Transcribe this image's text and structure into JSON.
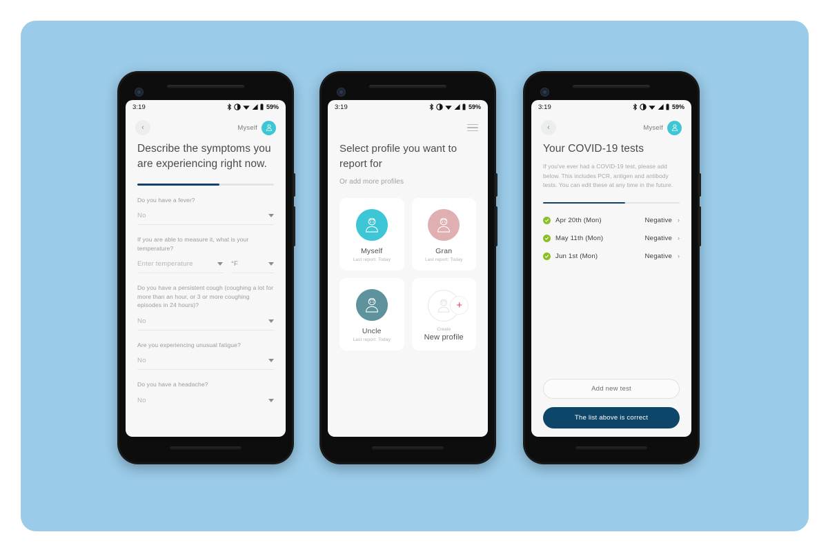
{
  "background": {
    "panel_color": "#9acbe9",
    "page_color": "#ffffff"
  },
  "colors": {
    "accent_teal": "#3cc6d6",
    "accent_navy": "#0d4668",
    "accent_green": "#8cbf26",
    "accent_pink": "#e0afb2",
    "accent_slate": "#5e929c",
    "accent_red": "#d9455c"
  },
  "status_bar": {
    "time": "3:19",
    "battery_percent": "59%",
    "icons": [
      "bluetooth-icon",
      "dnd-icon",
      "wifi-icon",
      "signal-icon",
      "battery-icon"
    ]
  },
  "screen1": {
    "app_bar": {
      "back_label": "‹",
      "profile_name": "Myself",
      "avatar": "person-avatar-icon"
    },
    "title": "Describe the symptoms you are experiencing right now.",
    "progress_percent": 60,
    "fields": [
      {
        "label": "Do you have a fever?",
        "value": "No",
        "type": "select"
      },
      {
        "label": "If you are able to measure it, what is your temperature?",
        "value": "Enter temperature",
        "type": "temperature",
        "unit": "°F"
      },
      {
        "label": "Do you have a persistent cough (coughing a lot for more than an hour, or 3 or more coughing episodes in 24 hours)?",
        "value": "No",
        "type": "select"
      },
      {
        "label": "Are you experiencing unusual fatigue?",
        "value": "No",
        "type": "select"
      },
      {
        "label": "Do you have a headache?",
        "value": "No",
        "type": "select"
      }
    ]
  },
  "screen2": {
    "app_bar": {
      "menu": "hamburger-menu-icon"
    },
    "title": "Select profile you want to report for",
    "subtitle": "Or add more profiles",
    "profiles": [
      {
        "name": "Myself",
        "last_report": "Last report: Today",
        "color": "#3cc6d6"
      },
      {
        "name": "Gran",
        "last_report": "Last report: Today",
        "color": "#e0afb2"
      },
      {
        "name": "Uncle",
        "last_report": "Last report: Today",
        "color": "#5e929c"
      }
    ],
    "new_profile": {
      "create_label": "Create",
      "name": "New profile"
    }
  },
  "screen3": {
    "app_bar": {
      "back_label": "‹",
      "profile_name": "Myself",
      "avatar": "person-avatar-icon"
    },
    "title": "Your COVID-19 tests",
    "paragraph": "If you've ever had a COVID-19 test,  please add below. This includes PCR, antigen and antibody tests. You can edit these at any time in the future.",
    "progress_percent": 60,
    "tests": [
      {
        "date": "Apr 20th (Mon)",
        "result": "Negative"
      },
      {
        "date": "May 11th (Mon)",
        "result": "Negative"
      },
      {
        "date": "Jun 1st (Mon)",
        "result": "Negative"
      }
    ],
    "add_button": "Add new test",
    "confirm_button": "The list above is correct"
  }
}
